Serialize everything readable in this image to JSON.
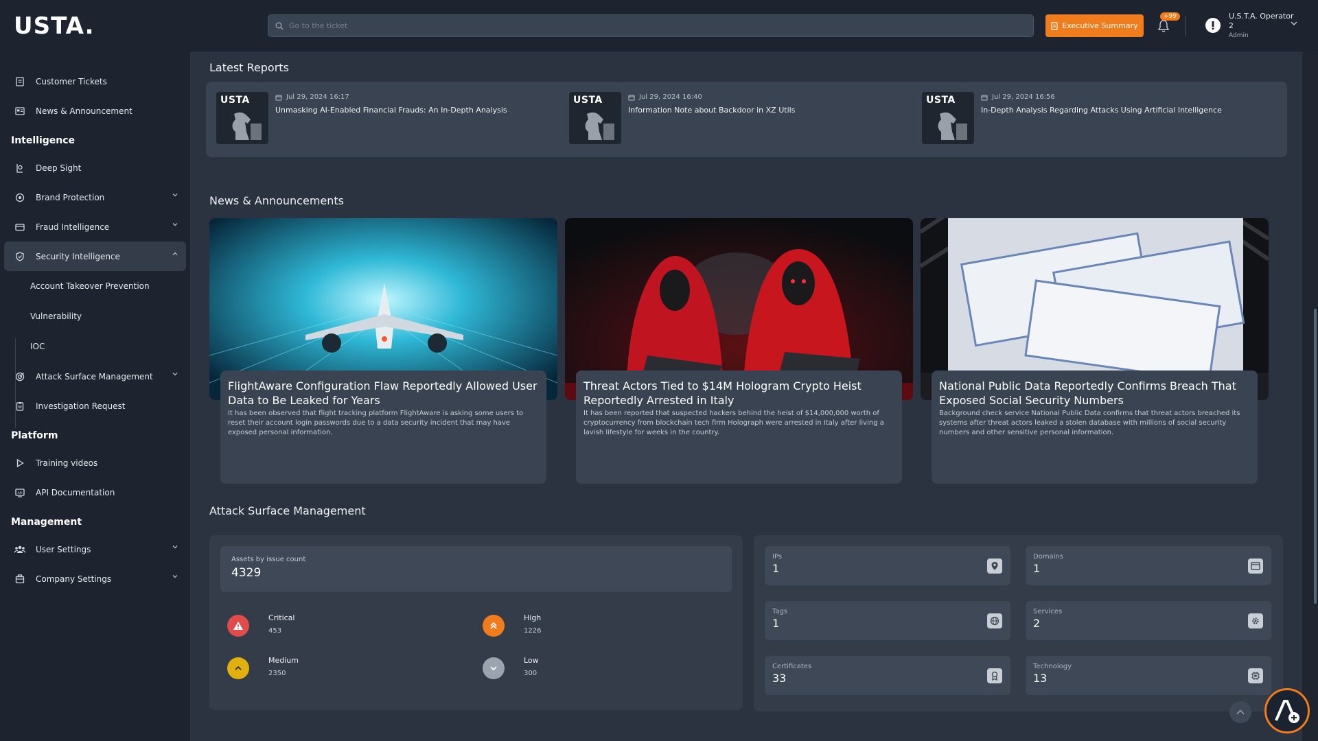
{
  "header": {
    "logo": "USTA.",
    "search_placeholder": "Go to the ticket",
    "exec_button": "Executive Summary",
    "notifications_badge": "+99",
    "user_name": "U.S.T.A. Operator",
    "user_id": "2",
    "user_role": "Admin"
  },
  "sidebar": {
    "top_items": [
      {
        "label": "Customer Tickets",
        "icon": "ticket-icon"
      },
      {
        "label": "News & Announcement",
        "icon": "newspaper-icon"
      }
    ],
    "intelligence_title": "Intelligence",
    "intel_items": [
      {
        "label": "Deep Sight",
        "icon": "deep-sight-icon"
      },
      {
        "label": "Brand Protection",
        "icon": "brand-icon"
      },
      {
        "label": "Fraud Intelligence",
        "icon": "card-icon"
      },
      {
        "label": "Security Intelligence",
        "icon": "shield-icon"
      }
    ],
    "security_sub_items": [
      {
        "label": "Account Takeover Prevention"
      },
      {
        "label": "Vulnerability"
      },
      {
        "label": "IOC"
      }
    ],
    "intel_items_2": [
      {
        "label": "Attack Surface Management",
        "icon": "target-icon"
      },
      {
        "label": "Investigation Request",
        "icon": "clipboard-icon"
      }
    ],
    "platform_title": "Platform",
    "platform_items": [
      {
        "label": "Training videos",
        "icon": "play-icon"
      },
      {
        "label": "API Documentation",
        "icon": "api-icon"
      }
    ],
    "management_title": "Management",
    "management_items": [
      {
        "label": "User Settings",
        "icon": "users-icon"
      },
      {
        "label": "Company Settings",
        "icon": "building-icon"
      }
    ]
  },
  "reports": {
    "title": "Latest Reports",
    "items": [
      {
        "brand": "USTA",
        "date": "Jul 29, 2024 16:17",
        "title": "Unmasking AI-Enabled Financial Frauds: An In-Depth Analysis"
      },
      {
        "brand": "USTA",
        "date": "Jul 29, 2024 16:40",
        "title": "Information Note about Backdoor in XZ Utils"
      },
      {
        "brand": "USTA",
        "date": "Jul 29, 2024 16:56",
        "title": "In-Depth Analysis Regarding Attacks Using Artificial Intelligence"
      }
    ]
  },
  "news": {
    "title": "News & Announcements",
    "items": [
      {
        "title": "FlightAware Configuration Flaw Reportedly Allowed User Data to Be Leaked for Years",
        "desc": "It has been observed that flight tracking platform FlightAware is asking some users to reset their account login passwords due to a data security incident that may have exposed personal information."
      },
      {
        "title": "Threat Actors Tied to $14M Hologram Crypto Heist Reportedly Arrested in Italy",
        "desc": "It has been reported that suspected hackers behind the heist of $14,000,000 worth of cryptocurrency from blockchain tech firm Holograph were arrested in Italy after living a lavish lifestyle for weeks in the country."
      },
      {
        "title": "National Public Data Reportedly Confirms Breach That Exposed Social Security Numbers",
        "desc": "Background check service National Public Data confirms that threat actors breached its systems after threat actors leaked a stolen database with millions of social security numbers and other sensitive personal information."
      }
    ]
  },
  "asm": {
    "title": "Attack Surface Management",
    "assets_label": "Assets by issue count",
    "assets_value": "4329",
    "severity": [
      {
        "label": "Critical",
        "value": "453",
        "color": "#e04b4b"
      },
      {
        "label": "High",
        "value": "1226",
        "color": "#f07c1c"
      },
      {
        "label": "Medium",
        "value": "2350",
        "color": "#e0b00f"
      },
      {
        "label": "Low",
        "value": "300",
        "color": "#9aa3ae"
      }
    ],
    "stats": [
      {
        "label": "IPs",
        "value": "1",
        "icon": "pin-icon"
      },
      {
        "label": "Domains",
        "value": "1",
        "icon": "window-icon"
      },
      {
        "label": "Tags",
        "value": "1",
        "icon": "globe-icon"
      },
      {
        "label": "Services",
        "value": "2",
        "icon": "gear-icon"
      },
      {
        "label": "Certificates",
        "value": "33",
        "icon": "certificate-icon"
      },
      {
        "label": "Technology",
        "value": "13",
        "icon": "chip-icon"
      }
    ]
  },
  "colors": {
    "accent": "#f07c1c",
    "sidebar_bg": "#1d2430",
    "main_bg": "#2b3340",
    "card_bg": "#3a4351"
  }
}
